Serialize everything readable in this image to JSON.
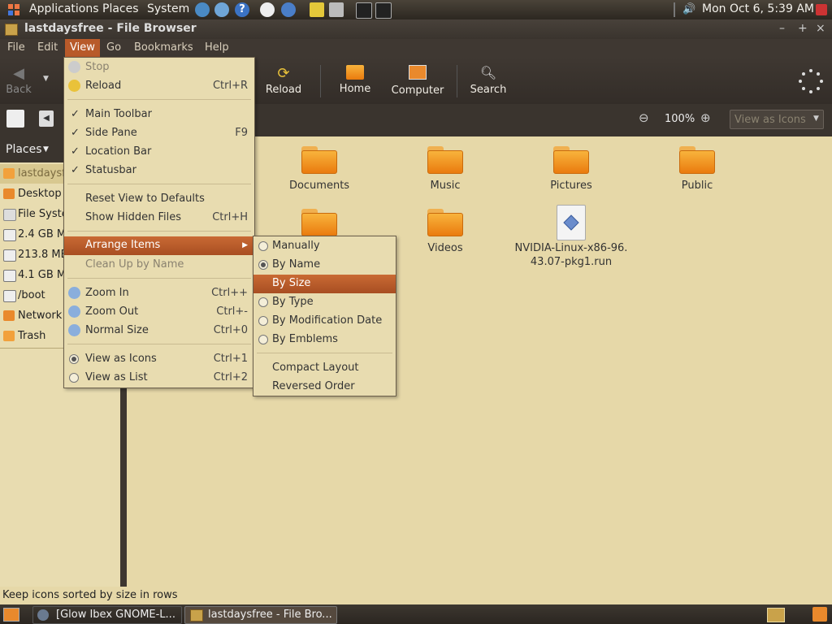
{
  "top_panel": {
    "applications": "Applications",
    "places": "Places",
    "system": "System",
    "clock": "Mon Oct  6,  5:39 AM"
  },
  "window": {
    "title": "lastdaysfree - File Browser",
    "controls": [
      "–",
      "+",
      "×"
    ]
  },
  "menubar": [
    "File",
    "Edit",
    "View",
    "Go",
    "Bookmarks",
    "Help"
  ],
  "toolbar": {
    "back": "Back",
    "reload": "Reload",
    "home": "Home",
    "computer": "Computer",
    "search": "Search"
  },
  "location": {
    "zoom": "100%",
    "view_as": "View as Icons"
  },
  "sidebar": {
    "header": "Places",
    "items": [
      {
        "label": "lastdaysfr",
        "icon": "home-folder-icon"
      },
      {
        "label": "Desktop",
        "icon": "desktop-icon"
      },
      {
        "label": "File Syste",
        "icon": "filesystem-icon"
      },
      {
        "label": "2.4 GB M",
        "icon": "drive-icon"
      },
      {
        "label": "213.8 ME",
        "icon": "drive-icon"
      },
      {
        "label": "4.1 GB M",
        "icon": "drive-icon"
      },
      {
        "label": "/boot",
        "icon": "drive-icon"
      },
      {
        "label": "Network",
        "icon": "network-icon"
      },
      {
        "label": "Trash",
        "icon": "trash-icon"
      }
    ]
  },
  "files": [
    {
      "name": "Documents",
      "type": "folder"
    },
    {
      "name": "Music",
      "type": "folder"
    },
    {
      "name": "Pictures",
      "type": "folder"
    },
    {
      "name": "Public",
      "type": "folder"
    },
    {
      "name": "",
      "type": "folder"
    },
    {
      "name": "Videos",
      "type": "folder"
    },
    {
      "name": "NVIDIA-Linux-x86-96.",
      "name2": "43.07-pkg1.run",
      "type": "file"
    }
  ],
  "view_menu": {
    "stop": "Stop",
    "reload": {
      "label": "Reload",
      "shortcut": "Ctrl+R"
    },
    "main_toolbar": "Main Toolbar",
    "side_pane": {
      "label": "Side Pane",
      "shortcut": "F9"
    },
    "location_bar": "Location Bar",
    "statusbar": "Statusbar",
    "reset_view": "Reset View to Defaults",
    "show_hidden": {
      "label": "Show Hidden Files",
      "shortcut": "Ctrl+H"
    },
    "arrange_items": "Arrange Items",
    "clean_up": "Clean Up by Name",
    "zoom_in": {
      "label": "Zoom In",
      "shortcut": "Ctrl++"
    },
    "zoom_out": {
      "label": "Zoom Out",
      "shortcut": "Ctrl+-"
    },
    "normal_size": {
      "label": "Normal Size",
      "shortcut": "Ctrl+0"
    },
    "view_icons": {
      "label": "View as Icons",
      "shortcut": "Ctrl+1"
    },
    "view_list": {
      "label": "View as List",
      "shortcut": "Ctrl+2"
    }
  },
  "arrange_menu": {
    "manually": "Manually",
    "by_name": "By Name",
    "by_size": "By Size",
    "by_type": "By Type",
    "by_mod_date": "By Modification Date",
    "by_emblems": "By Emblems",
    "compact": "Compact Layout",
    "reversed": "Reversed Order"
  },
  "statusbar": "Keep icons sorted by size in rows",
  "taskbar": {
    "task1": "[Glow Ibex GNOME-L...",
    "task2": "lastdaysfree - File Bro..."
  },
  "colors": {
    "highlight": "#b85a2a",
    "panel": "#3f3832",
    "background": "#e6d8a8"
  }
}
